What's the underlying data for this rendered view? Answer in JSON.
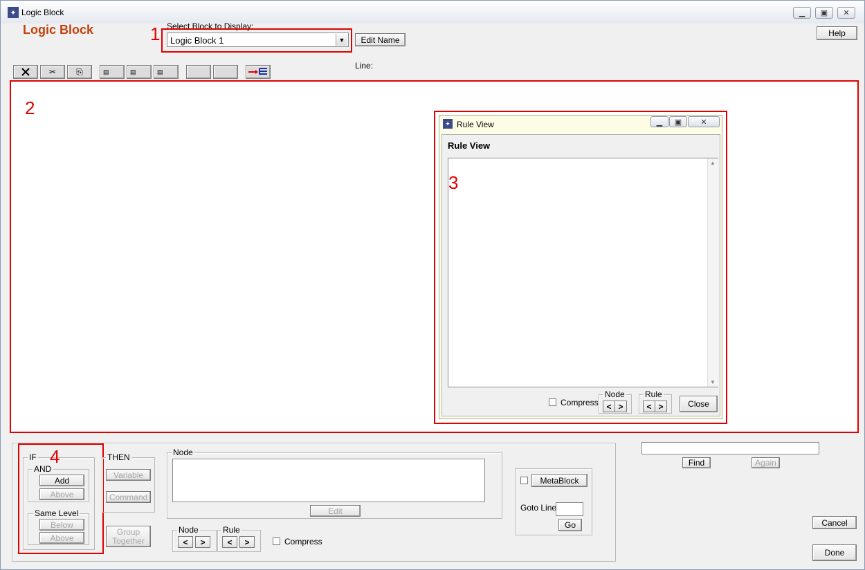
{
  "window": {
    "title": "Logic Block"
  },
  "header": {
    "heading": "Logic Block",
    "select_label": "Select Block to Display:",
    "select_value": "Logic Block 1",
    "edit_name_label": "Edit Name",
    "help_label": "Help",
    "line_label": "Line:"
  },
  "toolbar": {
    "icons": [
      "delete-icon",
      "cut-icon",
      "copy-icon",
      "node-icon-1",
      "node-icon-2",
      "node-icon-3",
      "blank-button-1",
      "blank-button-2",
      "tree-expand-icon"
    ]
  },
  "rule_view": {
    "window_title": "Rule View",
    "heading": "Rule View",
    "compress_label": "Compress",
    "node_group_label": "Node",
    "rule_group_label": "Rule",
    "prev_symbol": "<",
    "next_symbol": ">",
    "close_label": "Close"
  },
  "bottom": {
    "if_label": "IF",
    "and_label": "AND",
    "add_label": "Add",
    "above_label": "Above",
    "same_level_label": "Same Level",
    "below_label": "Below",
    "above2_label": "Above",
    "then_label": "THEN",
    "variable_label": "Variable",
    "command_label": "Command",
    "group_line1": "Group",
    "group_line2": "Together",
    "node_label": "Node",
    "edit_label": "Edit",
    "node_nav_label": "Node",
    "rule_nav_label": "Rule",
    "prev_symbol": "<",
    "next_symbol": ">",
    "compress_label": "Compress",
    "metablock_label": "MetaBlock",
    "goto_label": "Goto Line:",
    "go_label": "Go",
    "find_label": "Find",
    "again_label": "Again",
    "cancel_label": "Cancel",
    "done_label": "Done"
  },
  "annotations": {
    "n1": "1",
    "n2": "2",
    "n3": "3",
    "n4": "4"
  },
  "colors": {
    "heading": "#c2410c",
    "annotation_red": "#e00000",
    "rule_view_bg": "#fdfde6"
  }
}
